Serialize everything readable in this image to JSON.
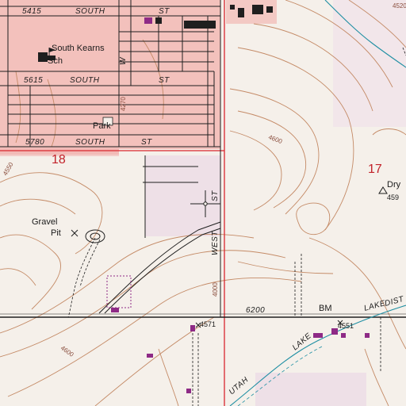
{
  "map": {
    "section_labels": {
      "west": "18",
      "east": "17"
    },
    "streets": {
      "s5415": "5415",
      "south_a": "SOUTH",
      "s5615": "5615",
      "south_b": "SOUTH",
      "st_b": "ST",
      "s5780": "5780",
      "south_c": "SOUTH",
      "st_c": "ST",
      "st_a": "ST",
      "w4270": "4270",
      "w_st_top": "W",
      "west_st": "WEST",
      "st_west": "ST",
      "w4000": "4000",
      "s6200": "6200",
      "utah_lake": "UTAH",
      "lake": "LAKE",
      "dist": "DIST"
    },
    "contours": {
      "c4600_center": "4600",
      "c4600_sw": "4600",
      "c4520": "4520",
      "c_west": "4550"
    },
    "features": {
      "school_name": "South Kearns",
      "school_abbr": "Sch",
      "park": "Park",
      "gravel": "Gravel",
      "pit": "Pit",
      "dry": "Dry",
      "dry_elev": "459",
      "bm": "BM",
      "bm_elev": "4551",
      "spot_elev": "4571"
    },
    "colors": {
      "urban_tint": "#f2b8b4",
      "road": "#1f1f1f",
      "contour": "#c48a66",
      "section_line": "#d9262e",
      "water": "#1f8fa3",
      "purple_building": "#8e2a86",
      "background": "#f5f0ea"
    },
    "marker": "crosshair"
  }
}
